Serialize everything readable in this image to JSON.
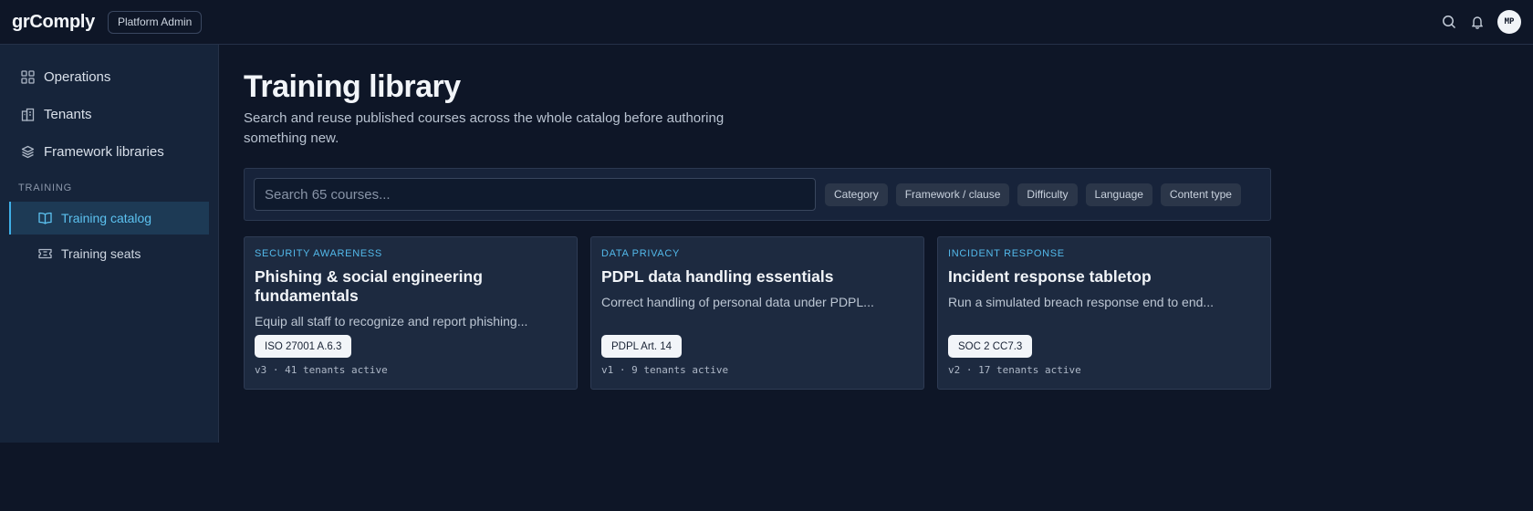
{
  "app": {
    "brand": "grComply",
    "role": "Platform Admin",
    "avatar_initials": "MP"
  },
  "colors": {
    "accent": "#3fb0e8",
    "background": "#0e1627",
    "sidebar": "#16243a",
    "card": "#1d2a40"
  },
  "header": {
    "icons": [
      "search-icon",
      "bell-icon"
    ]
  },
  "sidebar": {
    "items": [
      {
        "label": "Operations",
        "icon": "grid-icon"
      },
      {
        "label": "Tenants",
        "icon": "building-icon"
      },
      {
        "label": "Framework libraries",
        "icon": "layers-icon"
      }
    ],
    "section_label": "TRAINING",
    "sub_items": [
      {
        "label": "Training catalog",
        "icon": "book-open-icon",
        "active": true
      },
      {
        "label": "Training seats",
        "icon": "ticket-icon",
        "active": false
      }
    ]
  },
  "main": {
    "title": "Training library",
    "subtitle": "Search and reuse published courses across the whole catalog before authoring something new.",
    "search": {
      "placeholder": "Search 65 courses...",
      "value": ""
    },
    "filters": [
      "Category",
      "Framework / clause",
      "Difficulty",
      "Language",
      "Content type"
    ],
    "cards": [
      {
        "category": "SECURITY AWARENESS",
        "title": "Phishing & social engineering fundamentals",
        "description": "Equip all staff to recognize and report phishing...",
        "tag": "ISO 27001 A.6.3",
        "meta": "v3 · 41 tenants active"
      },
      {
        "category": "DATA PRIVACY",
        "title": "PDPL data handling essentials",
        "description": "Correct handling of personal data under PDPL...",
        "tag": "PDPL Art. 14",
        "meta": "v1 · 9 tenants active"
      },
      {
        "category": "INCIDENT RESPONSE",
        "title": "Incident response tabletop",
        "description": "Run a simulated breach response end to end...",
        "tag": "SOC 2 CC7.3",
        "meta": "v2 · 17 tenants active"
      }
    ]
  }
}
